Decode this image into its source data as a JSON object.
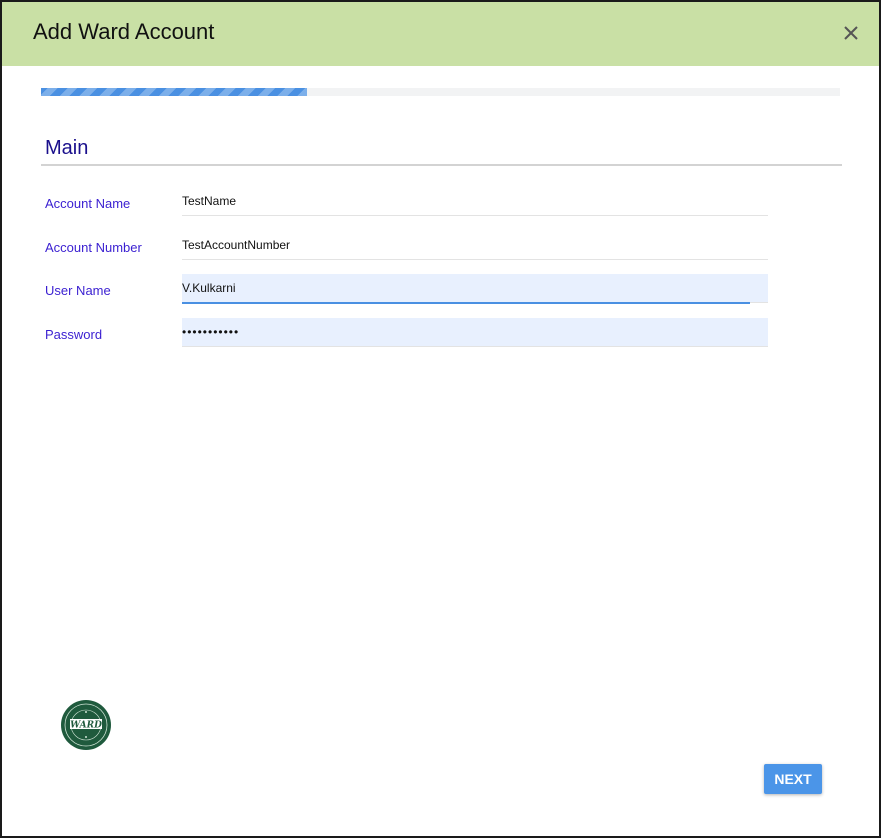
{
  "dialog": {
    "title": "Add Ward Account",
    "close_icon": "close-icon",
    "header_color": "#c9e0a5"
  },
  "progress": {
    "fraction": 0.333,
    "color": "#4a90e2"
  },
  "section": {
    "title": "Main"
  },
  "fields": {
    "account_name": {
      "label": "Account Name",
      "value": "TestName"
    },
    "account_number": {
      "label": "Account Number",
      "value": "TestAccountNumber"
    },
    "user_name": {
      "label": "User Name",
      "value": "V.Kulkarni"
    },
    "password": {
      "label": "Password",
      "value": "•••••••••••"
    }
  },
  "logo": {
    "icon": "ward-logo-icon",
    "text": "WARD"
  },
  "actions": {
    "next_label": "NEXT",
    "accent_color": "#4b95e8"
  }
}
